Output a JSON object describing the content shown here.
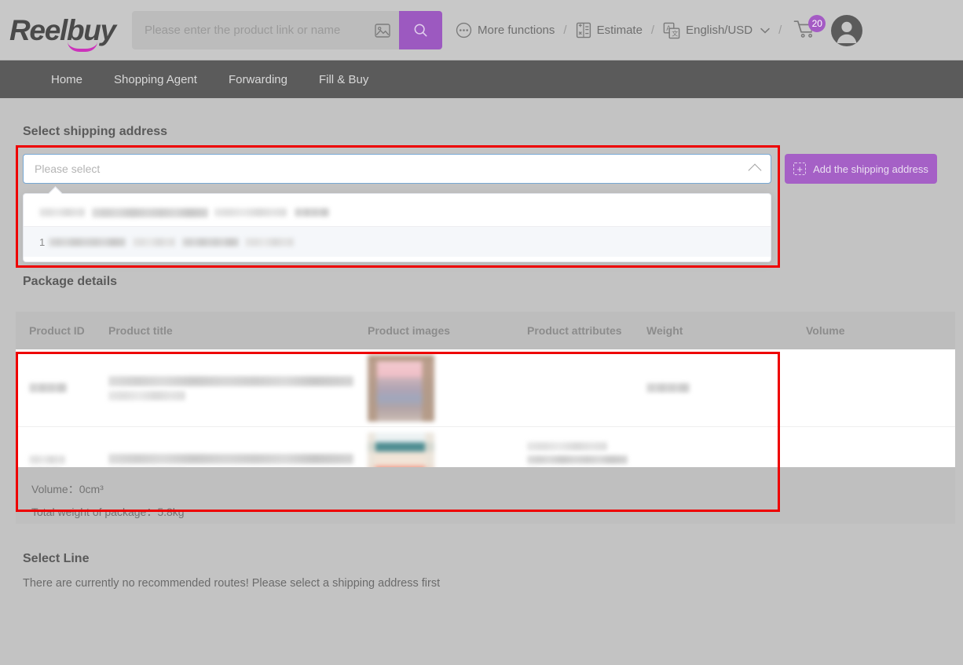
{
  "brand": {
    "name": "Reelbuy",
    "accent": "#9c59c0",
    "smile_color": "#cc33bb"
  },
  "header": {
    "search": {
      "placeholder": "Please enter the product link or name",
      "value": "",
      "image_search_icon": "image-search-icon",
      "search_icon": "search-icon"
    },
    "links": [
      {
        "label": "More functions",
        "icon": "ellipsis-circle-icon"
      },
      {
        "label": "Estimate",
        "icon": "calculator-icon"
      },
      {
        "label": "English/USD",
        "icon": "translate-icon",
        "caret": "chevron-down-icon"
      }
    ],
    "separator": "/",
    "cart": {
      "icon": "cart-icon",
      "badge": "20"
    },
    "avatar": {
      "icon": "user-avatar-icon"
    }
  },
  "nav": {
    "items": [
      {
        "label": "Home"
      },
      {
        "label": "Shopping Agent"
      },
      {
        "label": "Forwarding"
      },
      {
        "label": "Fill & Buy"
      }
    ]
  },
  "address_section": {
    "title": "Select shipping address",
    "select": {
      "placeholder": "Please select",
      "value": "",
      "caret": "chevron-up-icon",
      "expanded": true
    },
    "options": [
      {
        "prefix": "",
        "label": "",
        "redacted": true
      },
      {
        "prefix": "1",
        "label": "",
        "redacted": true
      }
    ],
    "add_button": {
      "label": "Add the shipping address",
      "icon": "plus-box-icon"
    }
  },
  "package_section": {
    "title": "Package details",
    "columns": [
      "Product ID",
      "Product title",
      "Product images",
      "Product attributes",
      "Weight",
      "Volume"
    ],
    "rows": [
      {
        "product_id": "",
        "product_title": "",
        "product_image": "product-image-1",
        "attributes": "",
        "weight": "",
        "volume": "",
        "redacted": true
      },
      {
        "product_id": "",
        "product_title": "",
        "product_image": "product-image-2",
        "attributes": "",
        "weight": "",
        "volume": "",
        "redacted": true
      }
    ],
    "summary": {
      "volume_label": "Volume：",
      "volume_value": "0cm³",
      "weight_label": "Total weight of package：",
      "weight_value": "5.8kg"
    }
  },
  "line_section": {
    "title": "Select Line",
    "empty_message": "There are currently no recommended routes! Please select a shipping address first"
  },
  "annotations": {
    "color": "#ee0000",
    "boxes": [
      {
        "name": "address-select-highlight"
      },
      {
        "name": "package-rows-highlight"
      }
    ]
  }
}
